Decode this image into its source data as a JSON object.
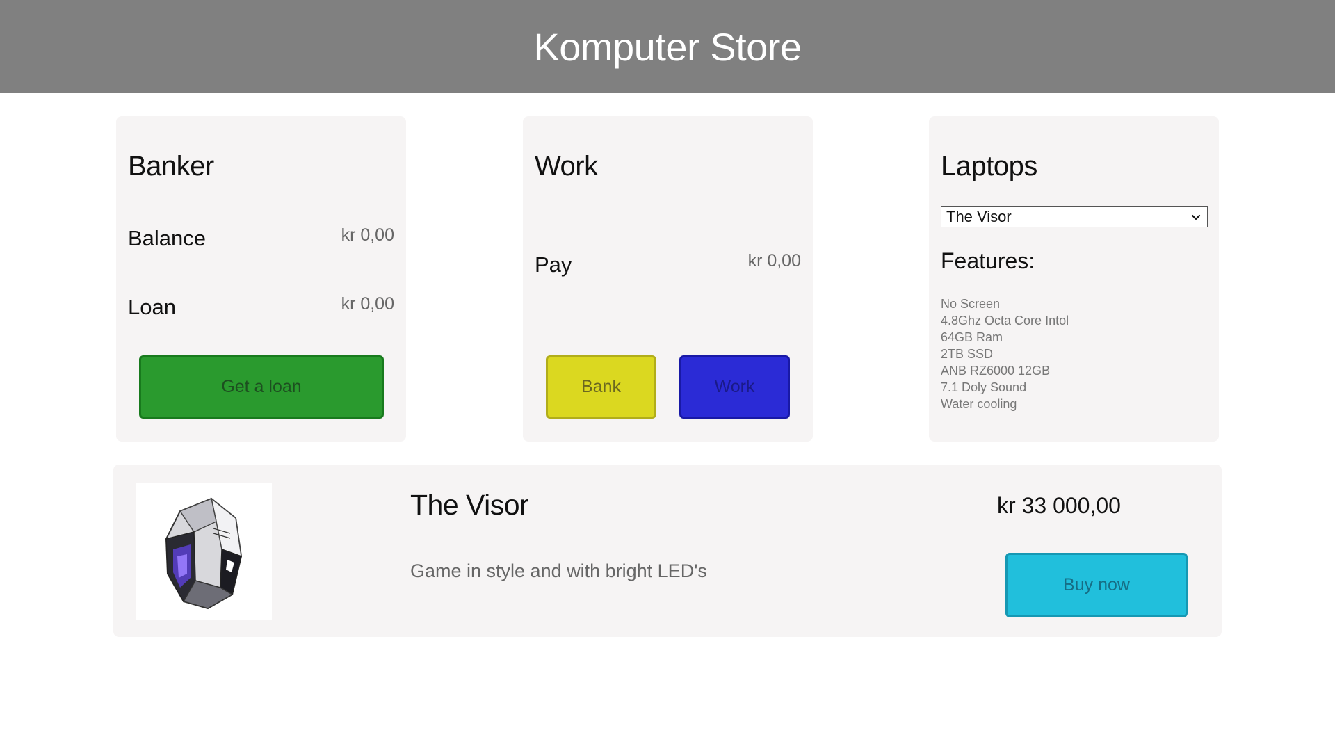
{
  "header": {
    "title": "Komputer Store"
  },
  "banker": {
    "title": "Banker",
    "balance_label": "Balance",
    "balance_value": "kr 0,00",
    "loan_label": "Loan",
    "loan_value": "kr 0,00",
    "loan_button": "Get a loan"
  },
  "work": {
    "title": "Work",
    "pay_label": "Pay",
    "pay_value": "kr 0,00",
    "bank_button": "Bank",
    "work_button": "Work"
  },
  "laptops": {
    "title": "Laptops",
    "selected": "The Visor",
    "features_label": "Features:",
    "features": [
      "No Screen",
      "4.8Ghz Octa Core Intol",
      "64GB Ram",
      "2TB SSD",
      "ANB RZ6000 12GB",
      "7.1 Doly Sound",
      "Water cooling"
    ]
  },
  "product": {
    "name": "The Visor",
    "description": "Game in style and with bright LED's",
    "price": "kr 33 000,00",
    "buy_button": "Buy now"
  },
  "colors": {
    "header_bg": "#808080",
    "card_bg": "#f6f4f4",
    "loan_button": "#2a9a2e",
    "bank_button": "#dbd820",
    "work_button": "#2b2bd6",
    "buy_button": "#21bfdc"
  }
}
